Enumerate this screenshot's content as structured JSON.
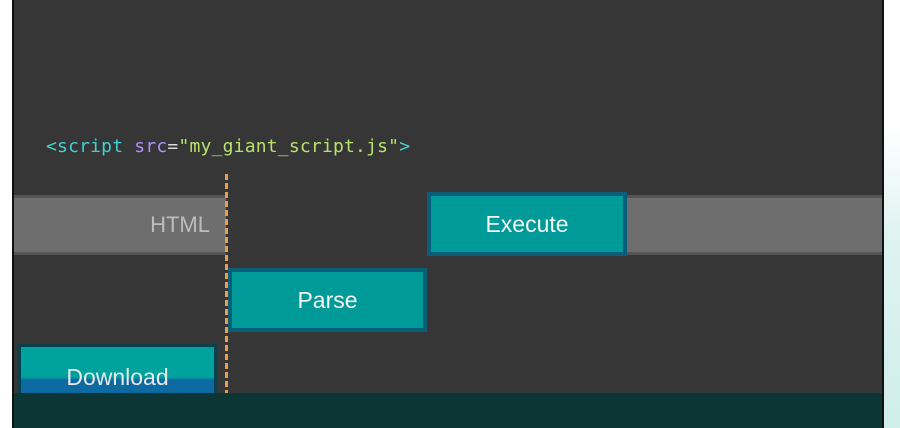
{
  "code": {
    "tag_open": "<script",
    "attr_name": " src",
    "equals": "=",
    "attr_value": "\"my_giant_script.js\"",
    "tag_close": ">"
  },
  "diagram": {
    "html_label": "HTML",
    "execute_label": "Execute",
    "parse_label": "Parse",
    "download_label": "Download"
  },
  "colors": {
    "panel_background": "#363636",
    "block_teal": "#009a98",
    "block_border": "#0a5e77",
    "html_bar_gray": "#6e6e6e",
    "marker_orange": "#e8a04a",
    "code_tag": "#42d1d1",
    "code_attr": "#b58cff",
    "code_string": "#b6e36b"
  }
}
